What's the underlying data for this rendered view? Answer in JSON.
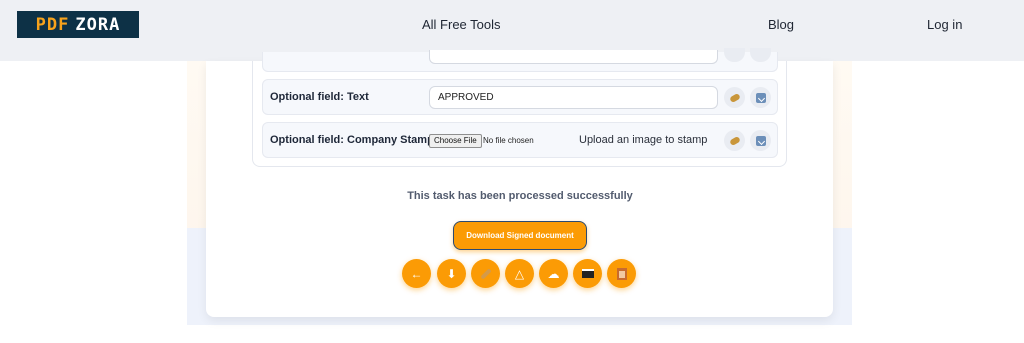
{
  "header": {
    "logo": {
      "part1": "PDF",
      "part2": "ZORA"
    },
    "nav": {
      "tools": "All Free Tools",
      "blog": "Blog",
      "login": "Log in"
    }
  },
  "fields": {
    "text_field": {
      "label_bold": "Optional field:",
      "label_rest": " Text",
      "value": "APPROVED"
    },
    "stamp_field": {
      "label_bold": "Optional field:",
      "label_rest": " Company Stamp",
      "file_button": "Choose File",
      "file_status": "No file chosen",
      "hint": "Upload an image to stamp"
    }
  },
  "result": {
    "message": "This task has been processed successfully",
    "download_label": "Download Signed document"
  },
  "actions": [
    {
      "icon": "back-arrow-icon",
      "glyph": "←"
    },
    {
      "icon": "download-icon",
      "glyph": "⬇"
    },
    {
      "icon": "edit-pen-icon",
      "glyph": ""
    },
    {
      "icon": "google-drive-icon",
      "glyph": "△"
    },
    {
      "icon": "cloud-upload-icon",
      "glyph": "☁"
    },
    {
      "icon": "dropbox-icon",
      "glyph": ""
    },
    {
      "icon": "delete-trash-icon",
      "glyph": ""
    }
  ],
  "colors": {
    "accent": "#fb9b05",
    "navbar": "#eef0f4",
    "logo_bg": "#0d3146"
  }
}
